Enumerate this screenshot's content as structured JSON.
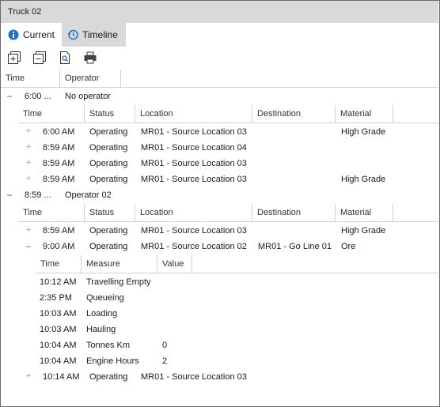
{
  "window": {
    "title": "Truck 02"
  },
  "tabs": [
    {
      "label": "Current",
      "icon": "info-icon",
      "active": true
    },
    {
      "label": "Timeline",
      "icon": "history-icon",
      "active": false
    }
  ],
  "toolbar": {
    "icons": [
      "expand-all-icon",
      "collapse-all-icon",
      "print-preview-icon",
      "print-icon"
    ]
  },
  "top_grid": {
    "columns": [
      "Time",
      "Operator"
    ],
    "groups": [
      {
        "time": "6:00 ...",
        "operator": "No operator",
        "expanded": "−",
        "columns": [
          "Time",
          "Status",
          "Location",
          "Destination",
          "Material"
        ],
        "rows": [
          {
            "time": "6:00 AM",
            "status": "Operating",
            "location": "MR01 - Source Location 03",
            "destination": "",
            "material": "High Grade"
          },
          {
            "time": "8:59 AM",
            "status": "Operating",
            "location": "MR01 - Source Location 04",
            "destination": "",
            "material": ""
          },
          {
            "time": "8:59 AM",
            "status": "Operating",
            "location": "MR01 - Source Location 03",
            "destination": "",
            "material": ""
          },
          {
            "time": "8:59 AM",
            "status": "Operating",
            "location": "MR01 - Source Location 03",
            "destination": "",
            "material": "High Grade"
          }
        ]
      },
      {
        "time": "8:59 ...",
        "operator": "Operator 02",
        "expanded": "−",
        "columns": [
          "Time",
          "Status",
          "Location",
          "Destination",
          "Material"
        ],
        "rows": [
          {
            "time": "8:59 AM",
            "status": "Operating",
            "location": "MR01 - Source Location 03",
            "destination": "",
            "material": "High Grade"
          },
          {
            "time": "9:00 AM",
            "status": "Operating",
            "location": "MR01 - Source Location 02",
            "destination": "MR01 - Go Line 01",
            "material": "Ore"
          },
          {
            "time": "10:14 AM",
            "status": "Operating",
            "location": "MR01 - Source Location 03",
            "destination": "",
            "material": ""
          }
        ],
        "detail": {
          "columns": [
            "Time",
            "Measure",
            "Value"
          ],
          "rows": [
            {
              "time": "10:12 AM",
              "measure": "Travelling Empty",
              "value": ""
            },
            {
              "time": "2:35 PM",
              "measure": "Queueing",
              "value": ""
            },
            {
              "time": "10:03 AM",
              "measure": "Loading",
              "value": ""
            },
            {
              "time": "10:03 AM",
              "measure": "Hauling",
              "value": ""
            },
            {
              "time": "10:04 AM",
              "measure": "Tonnes Km",
              "value": "0"
            },
            {
              "time": "10:04 AM",
              "measure": "Engine Hours",
              "value": "2"
            }
          ]
        }
      }
    ]
  },
  "glyphs": {
    "plus": "+",
    "minus": "−"
  },
  "colors": {
    "title_bg": "#d9d9d9",
    "info_blue": "#1e73c8",
    "grid_line": "#d0d0d0"
  }
}
